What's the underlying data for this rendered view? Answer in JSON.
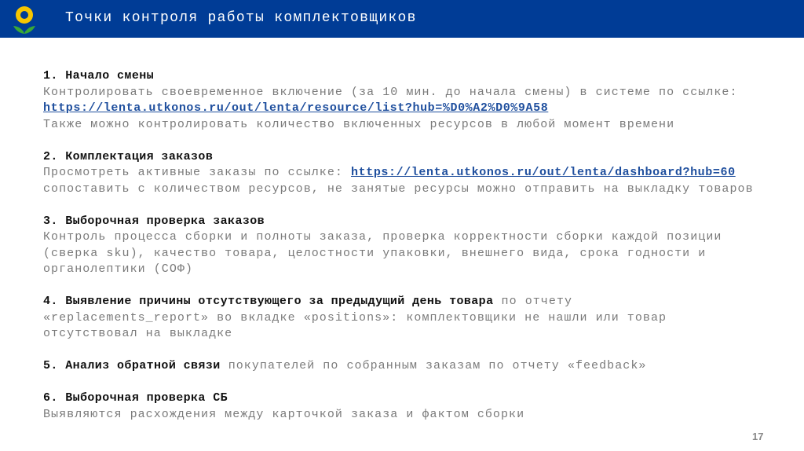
{
  "header": {
    "title": "Точки контроля работы комплектовщиков"
  },
  "sections": [
    {
      "heading": "1. Начало смены",
      "line1": "Контролировать своевременное включение (за 10 мин. до начала смены) в системе по ссылке:",
      "link": "https://lenta.utkonos.ru/out/lenta/resource/list?hub=%D0%A2%D0%9A58",
      "line3": "Также можно контролировать количество включенных ресурсов в любой момент времени"
    },
    {
      "heading": "2. Комплектация заказов",
      "line1_prefix": "Просмотреть активные заказы по ссылке: ",
      "link": "https://lenta.utkonos.ru/out/lenta/dashboard?hub=60",
      "line2": "сопоставить с количеством ресурсов, не занятые ресурсы можно отправить на выкладку товаров"
    },
    {
      "heading": "3. Выборочная проверка заказов",
      "line1": "Контроль процесса сборки и полноты заказа, проверка корректности сборки каждой позиции",
      "line2": "(сверка sku), качество товара, целостности упаковки, внешнего вида, срока годности и",
      "line3": "органолептики (СОФ)"
    },
    {
      "heading": "4. Выявление причины отсутствующего за предыдущий день товара",
      "line1_suffix": " по отчету",
      "line2": "«replacements_report» во вкладке «positions»: комплектовщики не нашли или товар",
      "line3": "отсутствовал на выкладке"
    },
    {
      "heading": "5. Анализ обратной связи",
      "line1_suffix": " покупателей по собранным заказам по отчету «feedback»"
    },
    {
      "heading": "6. Выборочная проверка СБ",
      "line1": "Выявляются расхождения между карточкой заказа и фактом сборки"
    }
  ],
  "page_number": "17",
  "colors": {
    "header_bg": "#003c96",
    "link": "#1f4f9e",
    "body_text": "#7a7a7a",
    "logo_yellow": "#f7c600",
    "logo_green": "#3aa935"
  }
}
